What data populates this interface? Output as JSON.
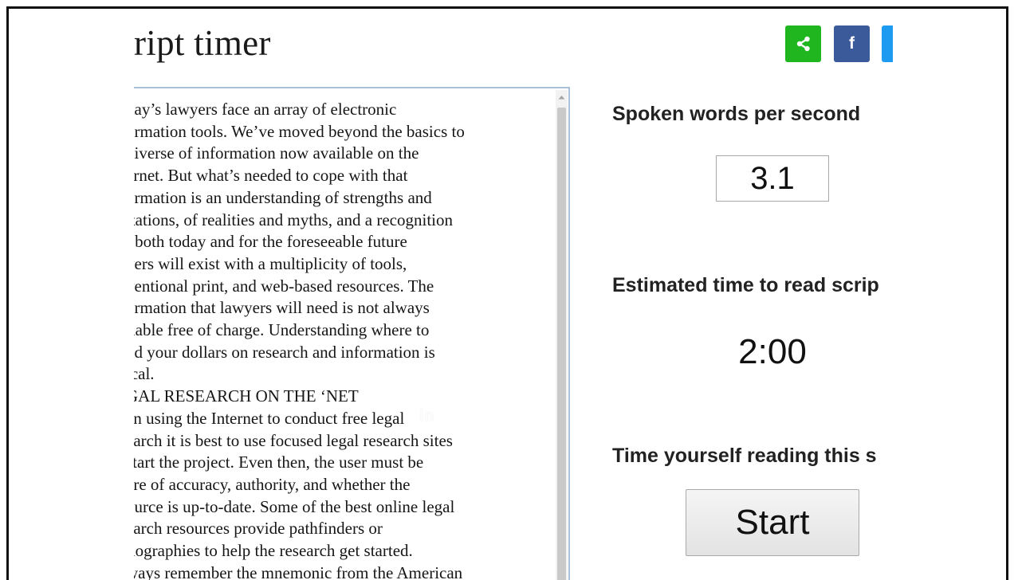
{
  "page": {
    "title": "ript timer"
  },
  "share": {
    "share_icon": "share-icon",
    "facebook_label": "f",
    "twitter_icon": "twitter-icon"
  },
  "script": {
    "lines": [
      "day’s lawyers face an array of electronic",
      "ormation tools. We’ve moved beyond the basics to",
      "niverse of information now available on the",
      "ernet. But what’s needed to cope with that",
      "ormation is an understanding of strengths and",
      "itations, of realities and myths, and a recognition",
      "t both today and for the foreseeable future",
      "yers will exist with a multiplicity of tools,",
      "ventional print, and web-based resources. The",
      "ormation that lawyers will need is not always",
      "ilable free of charge. Understanding where to",
      "nd your dollars on research and information is",
      "ical.",
      "GAL RESEARCH ON THE ‘NET",
      "en using the Internet to conduct free legal",
      "earch it is best to use focused legal research sites",
      "start the project. Even then, the user must be",
      "are of accuracy, authority, and whether the",
      "ource is up-to-date. Some of the best online legal",
      "earch resources provide pathfinders or",
      "liographies to help the research get started.",
      "ways remember the mnemonic from the American"
    ]
  },
  "overlay": {
    "text": "in"
  },
  "controls": {
    "words_per_second_label": "Spoken words per second",
    "words_per_second_value": "3.1",
    "estimated_time_label": "Estimated time to read scrip",
    "estimated_time_value": "2:00",
    "time_yourself_label": "Time yourself reading this s",
    "start_label": "Start"
  },
  "colors": {
    "share": "#1fb61f",
    "facebook": "#3b5a9a",
    "twitter": "#1d9bf0"
  }
}
